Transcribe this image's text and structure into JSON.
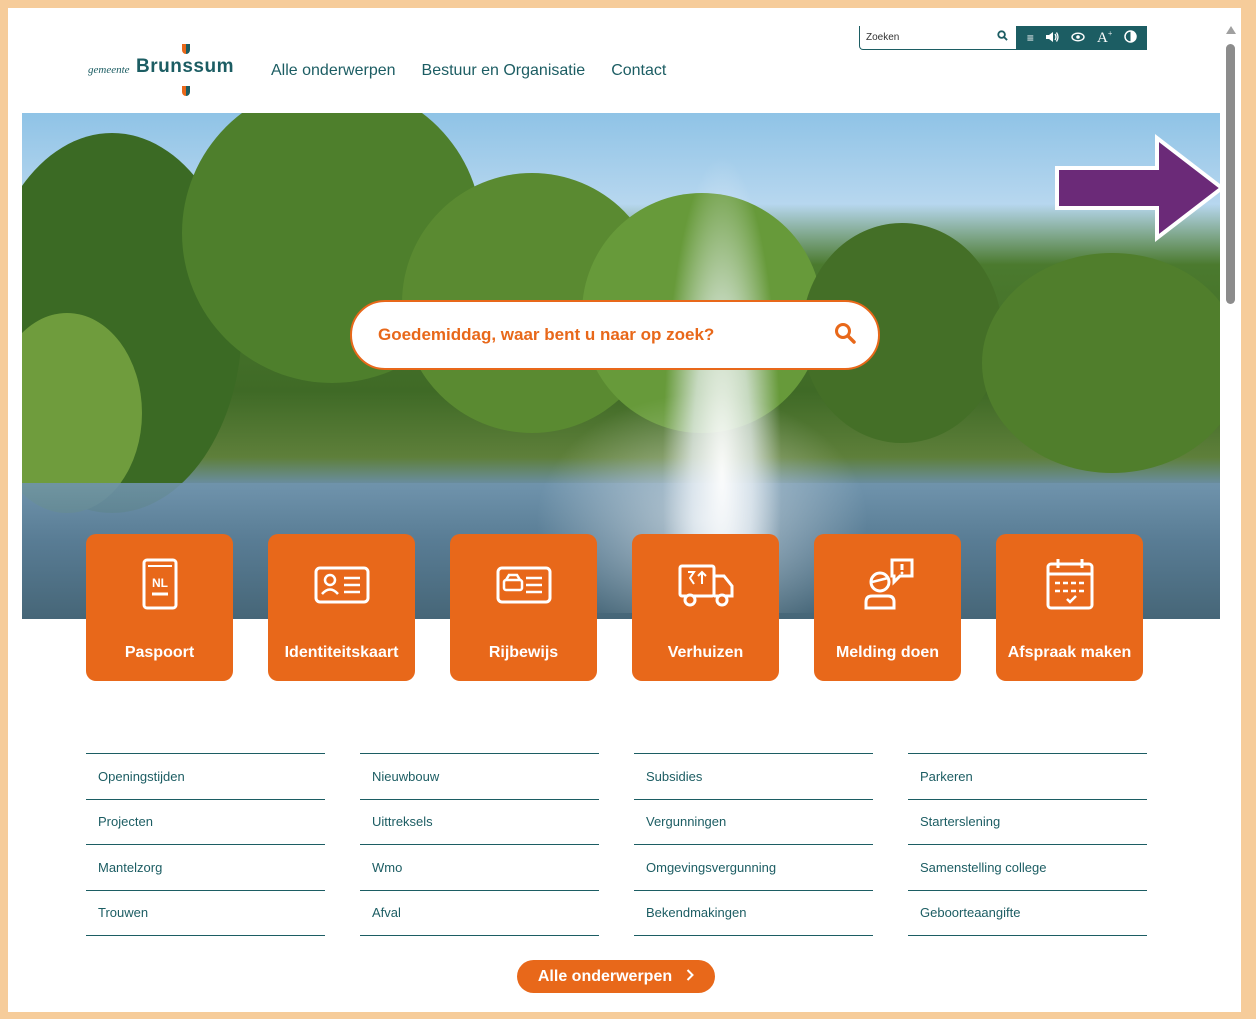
{
  "header": {
    "logo_prefix": "gemeente",
    "logo_name": "Brunssum",
    "nav": [
      "Alle onderwerpen",
      "Bestuur en Organisatie",
      "Contact"
    ]
  },
  "utility": {
    "search_placeholder": "Zoeken",
    "tools": [
      "search-icon",
      "menu-icon",
      "speaker-icon",
      "eye-icon",
      "font-size-icon",
      "contrast-icon"
    ]
  },
  "hero": {
    "search_placeholder": "Goedemiddag, waar bent u naar op zoek?"
  },
  "tiles": [
    {
      "label": "Paspoort",
      "icon": "passport-icon"
    },
    {
      "label": "Identiteitskaart",
      "icon": "id-card-icon"
    },
    {
      "label": "Rijbewijs",
      "icon": "drivers-license-icon"
    },
    {
      "label": "Verhuizen",
      "icon": "moving-truck-icon"
    },
    {
      "label": "Melding doen",
      "icon": "report-person-icon"
    },
    {
      "label": "Afspraak maken",
      "icon": "calendar-icon"
    }
  ],
  "links": [
    [
      "Openingstijden",
      "Projecten",
      "Mantelzorg",
      "Trouwen"
    ],
    [
      "Nieuwbouw",
      "Uittreksels",
      "Wmo",
      "Afval"
    ],
    [
      "Subsidies",
      "Vergunningen",
      "Omgevingsvergunning",
      "Bekendmakingen"
    ],
    [
      "Parkeren",
      "Starterslening",
      "Samenstelling college",
      "Geboorteaangifte"
    ]
  ],
  "all_button": "Alle onderwerpen",
  "colors": {
    "brand_orange": "#e8681a",
    "brand_teal": "#1c5d63",
    "frame": "#f6cc9a",
    "arrow": "#6b2a78"
  }
}
